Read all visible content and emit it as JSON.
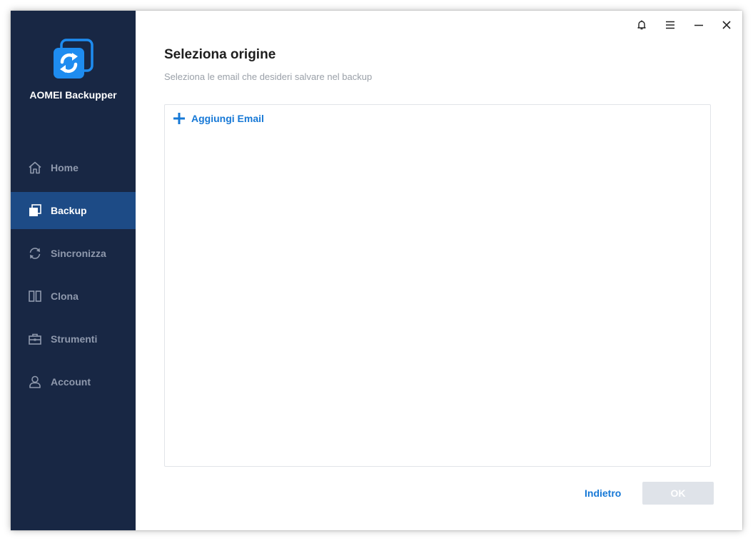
{
  "app": {
    "name": "AOMEI Backupper",
    "brand_color": "#1e8cf0",
    "sidebar_color": "#182744",
    "active_color": "#1d4b86"
  },
  "window_controls": [
    {
      "name": "notification-bell",
      "icon": "bell-icon"
    },
    {
      "name": "menu",
      "icon": "hamburger-menu-icon"
    },
    {
      "name": "minimize",
      "icon": "minimize-icon"
    },
    {
      "name": "close",
      "icon": "close-icon"
    }
  ],
  "sidebar": {
    "items": [
      {
        "label": "Home",
        "icon": "home-icon",
        "active": false
      },
      {
        "label": "Backup",
        "icon": "backup-icon",
        "active": true
      },
      {
        "label": "Sincronizza",
        "icon": "sync-icon",
        "active": false
      },
      {
        "label": "Clona",
        "icon": "clone-icon",
        "active": false
      },
      {
        "label": "Strumenti",
        "icon": "toolbox-icon",
        "active": false
      },
      {
        "label": "Account",
        "icon": "user-icon",
        "active": false
      }
    ]
  },
  "main": {
    "title": "Seleziona origine",
    "subtitle": "Seleziona le email che desideri salvare nel backup",
    "add_email_label": "Aggiungi Email",
    "back_label": "Indietro",
    "ok_label": "OK",
    "ok_enabled": false
  }
}
